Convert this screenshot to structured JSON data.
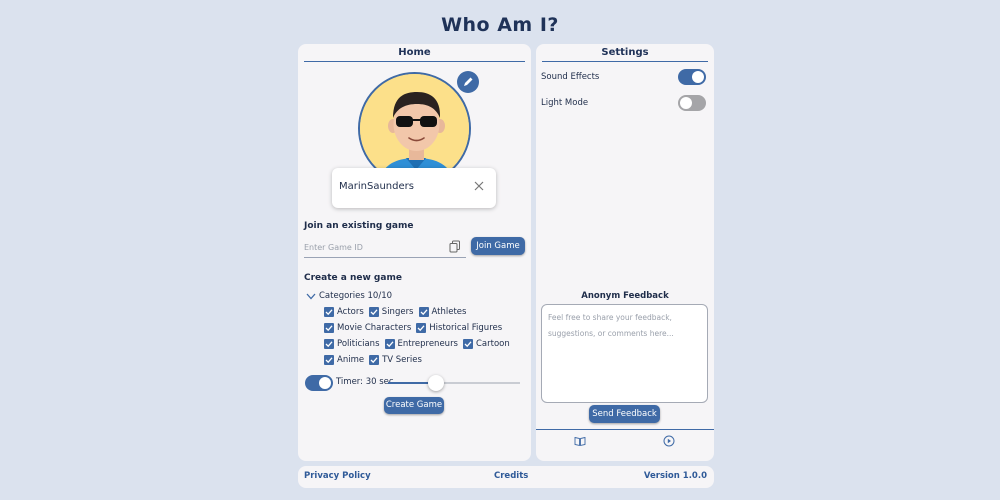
{
  "app": {
    "title": "Who Am I?"
  },
  "home": {
    "title": "Home",
    "username": "MarinSaunders",
    "join": {
      "heading": "Join an existing game",
      "placeholder": "Enter Game ID",
      "button": "Join Game"
    },
    "create": {
      "heading": "Create a new game",
      "categories_label": "Categories 10/10",
      "categories": [
        {
          "label": "Actors",
          "checked": true
        },
        {
          "label": "Singers",
          "checked": true
        },
        {
          "label": "Athletes",
          "checked": true
        },
        {
          "label": "Movie Characters",
          "checked": true
        },
        {
          "label": "Historical Figures",
          "checked": true
        },
        {
          "label": "Politicians",
          "checked": true
        },
        {
          "label": "Entrepreneurs",
          "checked": true
        },
        {
          "label": "Cartoon",
          "checked": true
        },
        {
          "label": "Anime",
          "checked": true
        },
        {
          "label": "TV Series",
          "checked": true
        }
      ],
      "timer_label": "Timer: 30 sec",
      "timer_enabled": true,
      "timer_slider_fraction": 0.36,
      "button": "Create Game"
    }
  },
  "settings": {
    "title": "Settings",
    "items": [
      {
        "label": "Sound Effects",
        "on": true
      },
      {
        "label": "Light Mode",
        "on": false
      }
    ],
    "feedback": {
      "title": "Anonym Feedback",
      "placeholder": "Feel free to share your feedback, suggestions, or comments here...",
      "button": "Send Feedback"
    },
    "bottom_icons": [
      "book-icon",
      "play-circle-icon"
    ]
  },
  "footer": {
    "privacy": "Privacy Policy",
    "credits": "Credits",
    "version": "Version 1.0.0"
  },
  "colors": {
    "background": "#dbe2ee",
    "panel": "#f6f5f7",
    "accent": "#3f6aa6",
    "avatar_bg": "#fce08a"
  }
}
